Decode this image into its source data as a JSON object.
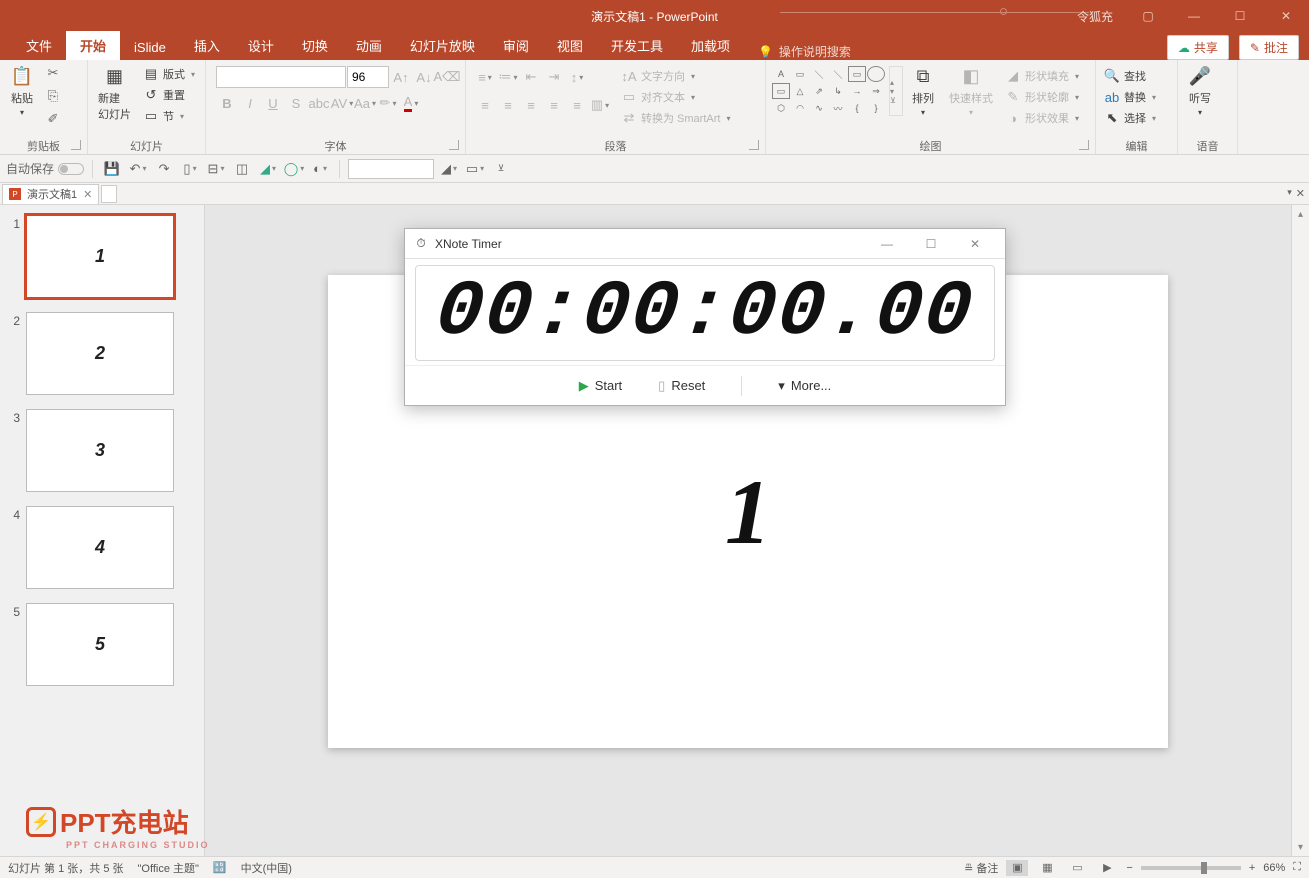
{
  "titlebar": {
    "doc_title": "演示文稿1",
    "app_name": "PowerPoint",
    "separator": " - ",
    "user": "令狐充"
  },
  "tabs": {
    "file": "文件",
    "home": "开始",
    "islide": "iSlide",
    "insert": "插入",
    "design": "设计",
    "transition": "切换",
    "animation": "动画",
    "slideshow": "幻灯片放映",
    "review": "审阅",
    "view": "视图",
    "developer": "开发工具",
    "addin": "加载项",
    "search_placeholder": "操作说明搜索",
    "share": "共享",
    "comment": "批注"
  },
  "ribbon": {
    "clipboard": {
      "label": "剪贴板",
      "paste": "粘贴"
    },
    "slides": {
      "label": "幻灯片",
      "new_slide": "新建\n幻灯片",
      "layout": "版式",
      "reset": "重置",
      "section": "节"
    },
    "font": {
      "label": "字体",
      "size_value": "96"
    },
    "paragraph": {
      "label": "段落",
      "text_dir": "文字方向",
      "align_text": "对齐文本",
      "smartart": "转换为 SmartArt"
    },
    "drawing": {
      "label": "绘图",
      "arrange": "排列",
      "quick_styles": "快速样式",
      "shape_fill": "形状填充",
      "shape_outline": "形状轮廓",
      "shape_effects": "形状效果"
    },
    "editing": {
      "label": "编辑",
      "find": "查找",
      "replace": "替换",
      "select": "选择"
    },
    "voice": {
      "label": "语音",
      "dictate": "听写"
    }
  },
  "qat": {
    "autosave": "自动保存"
  },
  "doc_tab": {
    "name": "演示文稿1"
  },
  "thumbnails": [
    {
      "num": "1",
      "content": "1",
      "selected": true
    },
    {
      "num": "2",
      "content": "2",
      "selected": false
    },
    {
      "num": "3",
      "content": "3",
      "selected": false
    },
    {
      "num": "4",
      "content": "4",
      "selected": false
    },
    {
      "num": "5",
      "content": "5",
      "selected": false
    }
  ],
  "canvas": {
    "slide_text": "1"
  },
  "statusbar": {
    "slide_info": "幻灯片 第 1 张，共 5 张",
    "theme": "\"Office 主题\"",
    "lang": "中文(中国)",
    "notes": "备注",
    "zoom": "66%"
  },
  "xnote": {
    "title": "XNote Timer",
    "time": "00:00:00.00",
    "start": "Start",
    "reset": "Reset",
    "more": "More..."
  },
  "watermark": {
    "main": "PPT充电站",
    "sub": "PPT CHARGING STUDIO"
  }
}
